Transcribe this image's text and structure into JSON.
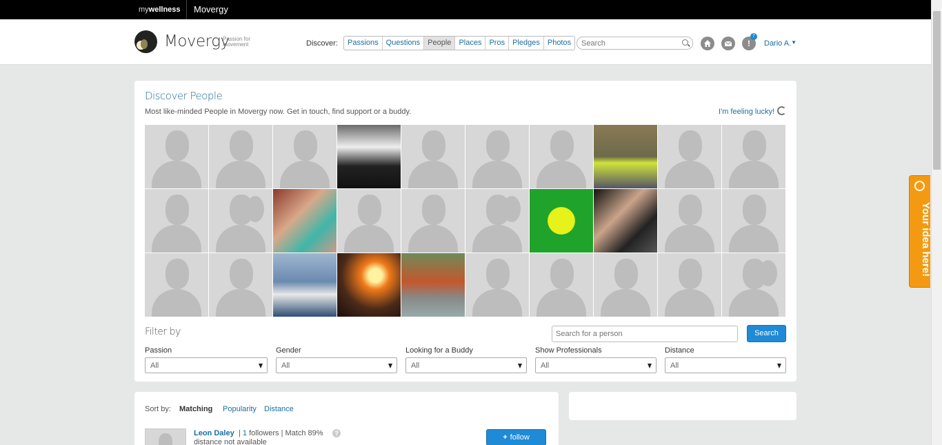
{
  "topbar": {
    "brand_prefix": "my",
    "brand_bold": "wellness",
    "app": "Movergy"
  },
  "header": {
    "logo_text": "Movergy",
    "tagline": "Passion for movement",
    "discover_label": "Discover:",
    "tabs": [
      {
        "label": "Passions",
        "active": false
      },
      {
        "label": "Questions",
        "active": false
      },
      {
        "label": "People",
        "active": true
      },
      {
        "label": "Places",
        "active": false
      },
      {
        "label": "Pros",
        "active": false
      },
      {
        "label": "Pledges",
        "active": false
      },
      {
        "label": "Photos",
        "active": false
      }
    ],
    "search_placeholder": "Search",
    "notification_count": "7",
    "user": "Dario A."
  },
  "discover": {
    "title": "Discover People",
    "subtitle": "Most like-minded People in Movergy now. Get in touch, find support or a buddy.",
    "lucky": "I'm feeling lucky!",
    "grid": [
      "male",
      "male",
      "male",
      "photo-stig",
      "male",
      "male",
      "male",
      "photo-runner",
      "male",
      "male",
      "male",
      "female",
      "photo-kids",
      "male",
      "male",
      "female",
      "photo-smiley",
      "photo-couple",
      "male",
      "male",
      "male",
      "male",
      "photo-boat",
      "photo-fire",
      "photo-skaters",
      "male",
      "male",
      "male",
      "male",
      "female"
    ]
  },
  "filter": {
    "title": "Filter by",
    "person_placeholder": "Search for a person",
    "search_button": "Search",
    "fields": [
      {
        "label": "Passion",
        "value": "All"
      },
      {
        "label": "Gender",
        "value": "All"
      },
      {
        "label": "Looking for a Buddy",
        "value": "All"
      },
      {
        "label": "Show Professionals",
        "value": "All"
      },
      {
        "label": "Distance",
        "value": "All"
      }
    ]
  },
  "list": {
    "sort_label": "Sort by:",
    "sort_options": [
      "Matching",
      "Popularity",
      "Distance"
    ],
    "people": [
      {
        "name": "Leon Daley",
        "followers_prefix": "|",
        "followers": "1",
        "followers_suffix": "followers | Match 89%",
        "distance": "distance not available",
        "follow": "follow"
      }
    ]
  },
  "side_tab": {
    "label": "Your idea here!"
  }
}
